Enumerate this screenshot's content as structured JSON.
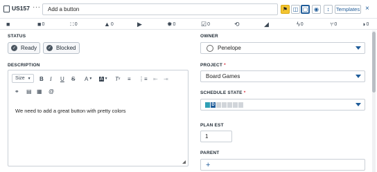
{
  "header": {
    "story_id": "US157",
    "more": "···",
    "title_value": "Add a button",
    "templates_label": "Templates",
    "close": "×"
  },
  "counts": [
    {
      "icon": "clipboard-icon",
      "glyph": "■",
      "value": "0"
    },
    {
      "icon": "sitemap-icon",
      "glyph": "∷",
      "value": "0"
    },
    {
      "icon": "flask-icon",
      "glyph": "▲",
      "value": "0"
    },
    {
      "icon": "play-icon",
      "glyph": "▶",
      "value": ""
    },
    {
      "icon": "bug-icon",
      "glyph": "✹",
      "value": "0"
    },
    {
      "icon": "checkbox-list-icon",
      "glyph": "☑",
      "value": "0"
    },
    {
      "icon": "history-icon",
      "glyph": "⟲",
      "value": ""
    },
    {
      "icon": "chart-icon",
      "glyph": "◢",
      "value": ""
    },
    {
      "icon": "bolt-icon",
      "glyph": "ϟ",
      "value": "0"
    },
    {
      "icon": "branch-icon",
      "glyph": "⑂",
      "value": "0"
    },
    {
      "icon": "globe-icon",
      "glyph": "◑",
      "value": "0"
    }
  ],
  "status": {
    "label": "STATUS",
    "ready": "Ready",
    "blocked": "Blocked"
  },
  "description": {
    "label": "DESCRIPTION",
    "size_label": "Size",
    "text": "We need to add a great button with pretty colors"
  },
  "owner": {
    "label": "OWNER",
    "value": "Penelope"
  },
  "project": {
    "label": "PROJECT",
    "required": "*",
    "value": "Board Games"
  },
  "schedule_state": {
    "label": "SCHEDULE STATE",
    "required": "*",
    "current": "D",
    "completed_steps": 1,
    "total_steps": 7
  },
  "plan_est": {
    "label": "PLAN EST",
    "value": "1"
  },
  "parent": {
    "label": "PARENT",
    "add": "+"
  },
  "colors": {
    "accent": "#1f5c99",
    "flag": "#f4c531",
    "schedule_done": "#2f9fb5"
  }
}
